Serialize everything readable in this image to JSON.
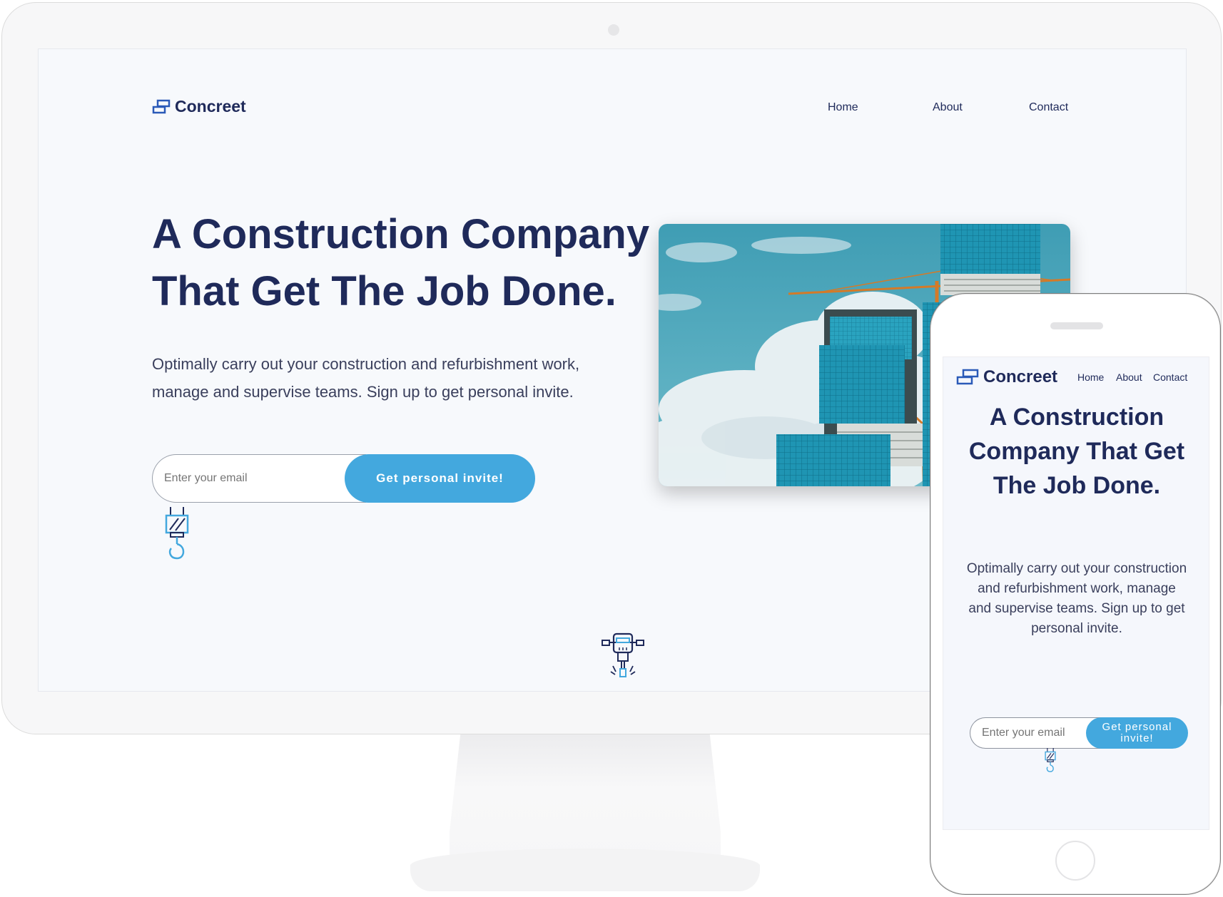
{
  "brand": {
    "name": "Concreet"
  },
  "nav": {
    "home": "Home",
    "about": "About",
    "contact": "Contact"
  },
  "hero": {
    "title": "A Construction Company That Get The Job Done.",
    "description": "Optimally carry out your construction and refurbishment work, manage and supervise teams. Sign up to get personal invite.",
    "email_placeholder": "Enter your email",
    "cta_label": "Get personal invite!"
  },
  "colors": {
    "navy": "#1f2a5a",
    "accent_blue": "#43a8de",
    "logo_blue": "#2b5ab8",
    "page_bg": "#f7f9fc"
  },
  "icons": {
    "logo": "stacked-blocks-icon",
    "hook": "crane-hook-icon",
    "drill": "jackhammer-icon"
  }
}
